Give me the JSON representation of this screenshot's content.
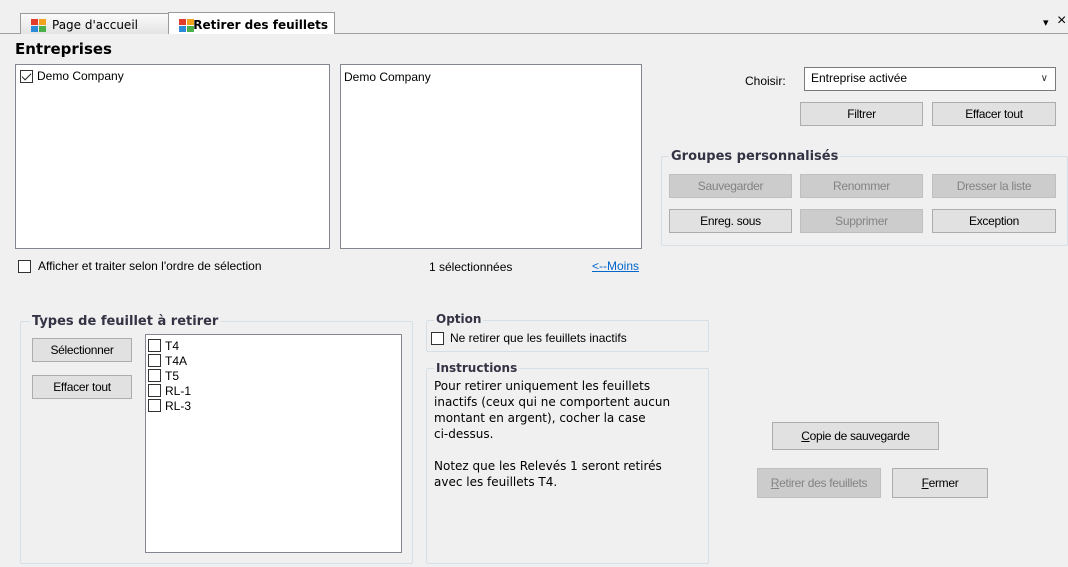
{
  "tabs": [
    {
      "label": "Page d'accueil",
      "active": false
    },
    {
      "label": "Retirer des feuillets",
      "active": true
    }
  ],
  "tab_controls": {
    "dropdown": "▾",
    "close": "×"
  },
  "companies": {
    "title": "Entreprises",
    "available": [
      {
        "label": "Demo Company",
        "checked": true
      }
    ],
    "selected": [
      "Demo Company"
    ],
    "order_checkbox_label": "Afficher et traiter selon l'ordre de sélection",
    "order_checked": false,
    "selected_count": "1 sélectionnées",
    "less_link": "<--Moins"
  },
  "filter": {
    "choose_label": "Choisir:",
    "choose_value": "Entreprise activée",
    "filter_button": "Filtrer",
    "clear_all_button": "Effacer tout"
  },
  "custom_groups": {
    "title": "Groupes personnalisés",
    "save": "Sauvegarder",
    "rename": "Renommer",
    "list": "Dresser la liste",
    "save_as": "Enreg. sous",
    "delete": "Supprimer",
    "exception": "Exception"
  },
  "slip_types": {
    "title": "Types de feuillet à retirer",
    "select_button": "Sélectionner",
    "clear_all_button": "Effacer tout",
    "items": [
      {
        "label": "T4",
        "checked": false
      },
      {
        "label": "T4A",
        "checked": false
      },
      {
        "label": "T5",
        "checked": false
      },
      {
        "label": "RL-1",
        "checked": false
      },
      {
        "label": "RL-3",
        "checked": false
      }
    ]
  },
  "option": {
    "title": "Option",
    "inactive_only_label": "Ne retirer que les feuillets inactifs",
    "inactive_only_checked": false
  },
  "instructions": {
    "title": "Instructions",
    "paragraph1_lines": [
      "Pour retirer uniquement les feuillets",
      "inactifs (ceux qui ne comportent aucun",
      "montant en argent), cocher la case",
      "ci-dessus."
    ],
    "paragraph2_lines": [
      "Notez que les Relevés 1 seront retirés",
      "avec les feuillets T4."
    ]
  },
  "actions": {
    "backup_prefix": "",
    "backup_mnemonic": "C",
    "backup_rest": "opie de sauvegarde",
    "remove_mnemonic": "R",
    "remove_rest": "etirer des feuillets",
    "close_mnemonic": "F",
    "close_rest": "ermer"
  }
}
